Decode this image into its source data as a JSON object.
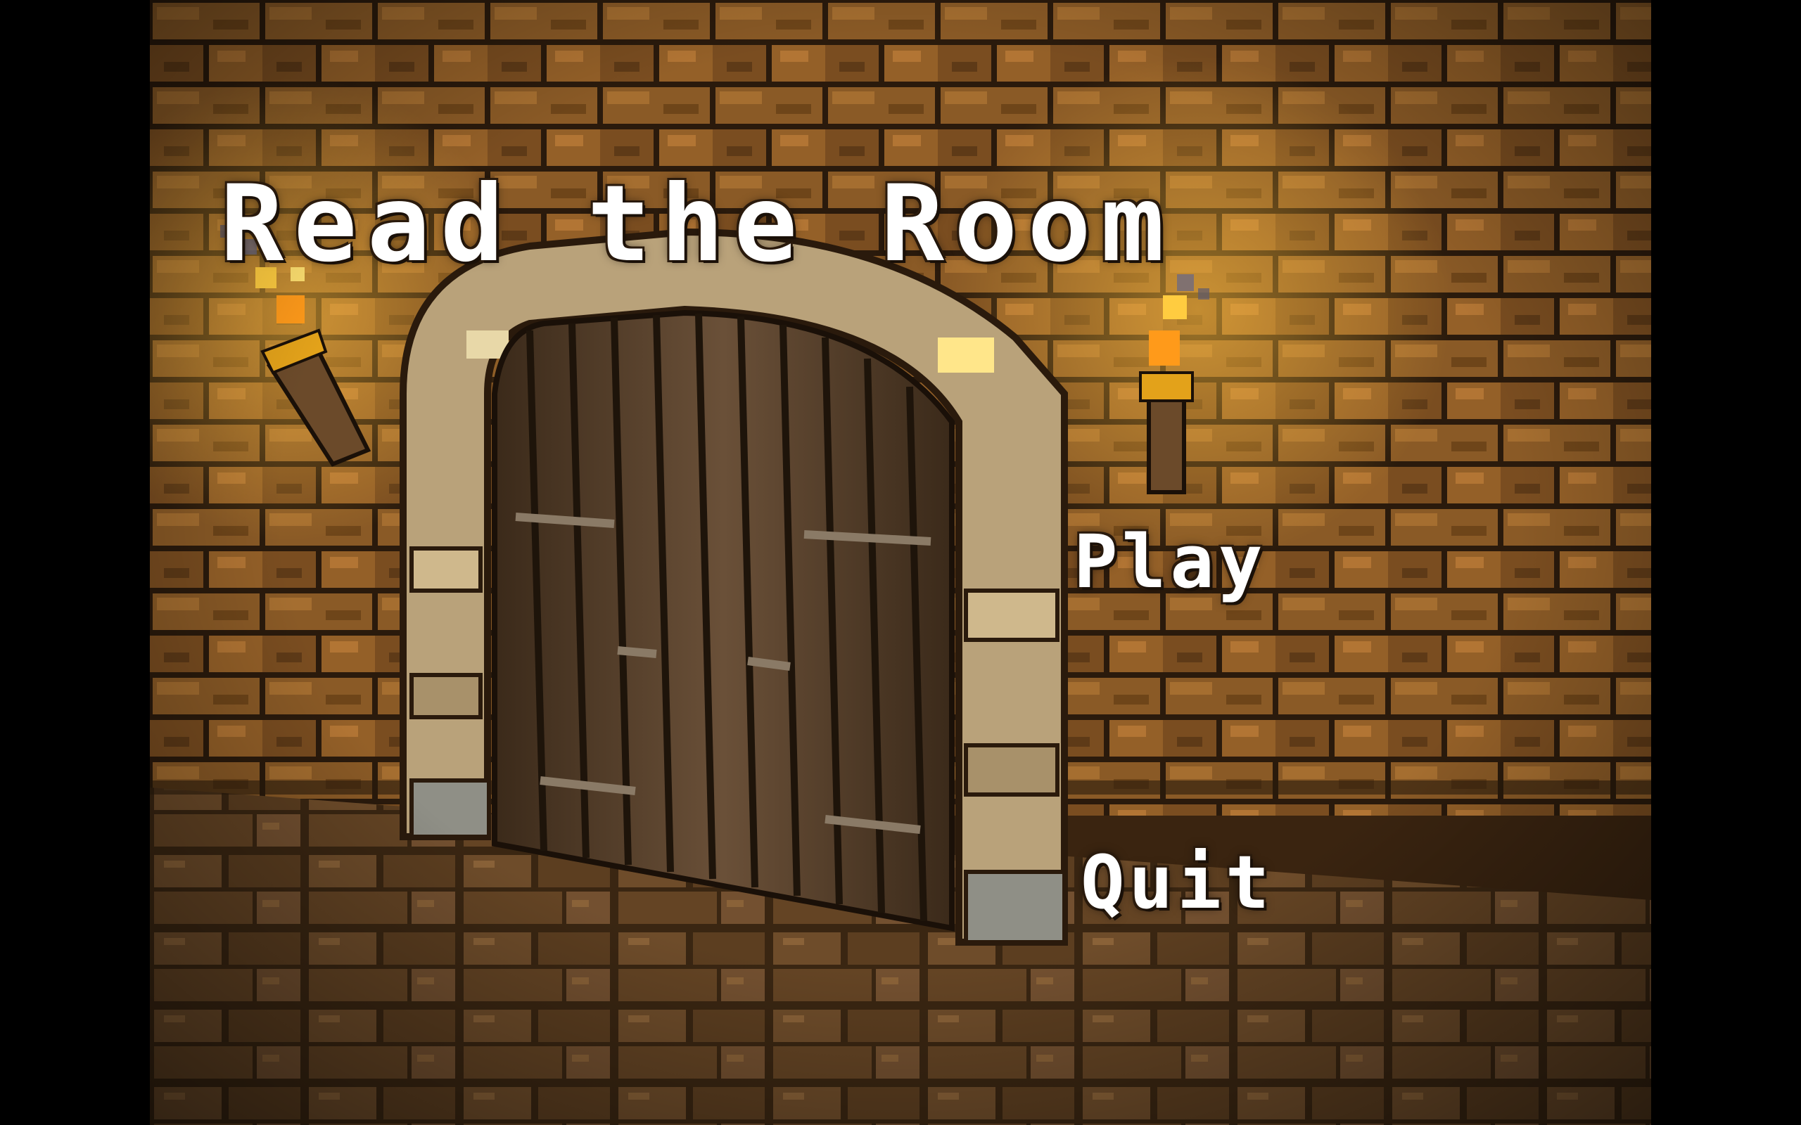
{
  "game": {
    "title": "Read the Room"
  },
  "menu": {
    "play_label": "Play",
    "quit_label": "Quit"
  },
  "colors": {
    "letterbox": "#000000",
    "wall_brick_light": "#c98a3c",
    "wall_brick_dark": "#5a3716",
    "mortar": "#2a1a0c",
    "door_wood": "#5e4630",
    "door_frame_stone": "#b9a27a",
    "floor": "#6a4a2a",
    "torch_flame": "#ffb020",
    "menu_text": "#ffffff"
  },
  "icons": {
    "left_torch": "wall-torch-icon",
    "right_torch": "wall-torch-icon"
  }
}
